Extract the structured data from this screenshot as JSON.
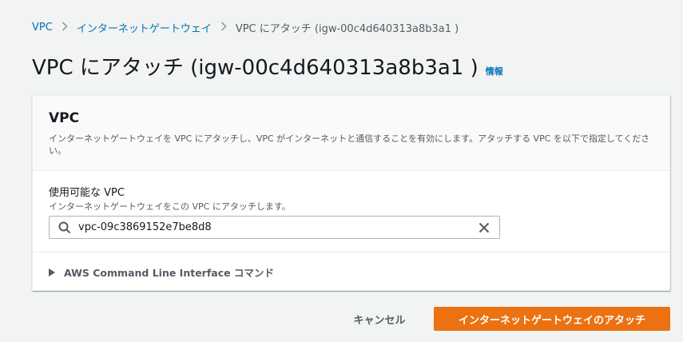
{
  "breadcrumb": {
    "items": [
      "VPC",
      "インターネットゲートウェイ"
    ],
    "current": "VPC にアタッチ (igw-00c4d640313a8b3a1 )"
  },
  "header": {
    "title": "VPC にアタッチ (igw-00c4d640313a8b3a1 )",
    "info_link": "情報"
  },
  "panel": {
    "title": "VPC",
    "description": "インターネットゲートウェイを VPC にアタッチし、VPC がインターネットと通信することを有効にします。アタッチする VPC を以下で指定してください。",
    "field": {
      "label": "使用可能な VPC",
      "description": "インターネットゲートウェイをこの VPC にアタッチします。",
      "value": "vpc-09c3869152e7be8d8"
    },
    "expander_label": "AWS Command Line Interface コマンド"
  },
  "actions": {
    "cancel": "キャンセル",
    "submit": "インターネットゲートウェイのアタッチ"
  },
  "icons": {
    "search": "search-icon",
    "clear": "close-icon",
    "caret": "caret-right-icon",
    "separator": "chevron-right-icon"
  },
  "colors": {
    "link": "#0073bb",
    "primary": "#ec7211",
    "background": "#f2f3f3"
  }
}
